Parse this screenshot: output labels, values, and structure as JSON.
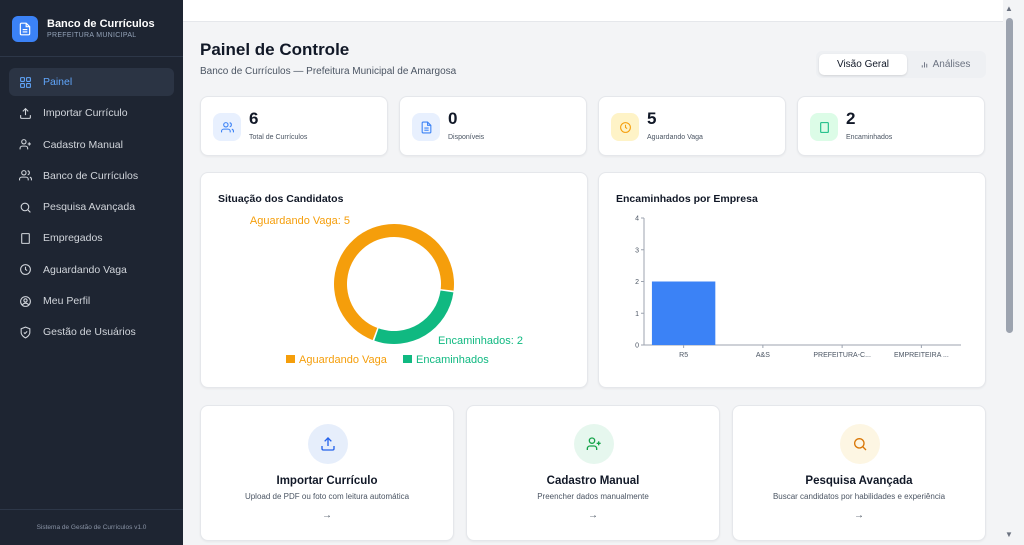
{
  "sidebar": {
    "brand_title": "Banco de Currículos",
    "brand_subtitle": "PREFEITURA MUNICIPAL",
    "items": [
      {
        "label": "Painel",
        "icon": "grid-icon",
        "active": true
      },
      {
        "label": "Importar Currículo",
        "icon": "upload-icon"
      },
      {
        "label": "Cadastro Manual",
        "icon": "user-plus-icon"
      },
      {
        "label": "Banco de Currículos",
        "icon": "users-icon"
      },
      {
        "label": "Pesquisa Avançada",
        "icon": "search-icon"
      },
      {
        "label": "Empregados",
        "icon": "building-icon"
      },
      {
        "label": "Aguardando Vaga",
        "icon": "clock-icon"
      },
      {
        "label": "Meu Perfil",
        "icon": "user-circle-icon"
      },
      {
        "label": "Gestão de Usuários",
        "icon": "shield-icon"
      }
    ],
    "footer": "Sistema de Gestão de Currículos v1.0"
  },
  "header": {
    "title": "Painel de Controle",
    "subtitle": "Banco de Currículos — Prefeitura Municipal de Amargosa",
    "tabs": [
      {
        "label": "Visão Geral",
        "active": true
      },
      {
        "label": "Análises",
        "icon": "bar-chart-icon"
      }
    ]
  },
  "stats": [
    {
      "value": "6",
      "label": "Total de Currículos",
      "icon": "users-icon"
    },
    {
      "value": "0",
      "label": "Disponíveis",
      "icon": "document-icon"
    },
    {
      "value": "5",
      "label": "Aguardando Vaga",
      "icon": "clock-icon"
    },
    {
      "value": "2",
      "label": "Encaminhados",
      "icon": "building-icon"
    }
  ],
  "colors": {
    "accent": "#3b82f6",
    "waiting": "#f59e0b",
    "forwarded": "#10b981",
    "sidebar_bg": "#1e2532"
  },
  "chart_data": [
    {
      "type": "pie",
      "title": "Situação dos Candidatos",
      "slices": [
        {
          "name": "Aguardando Vaga",
          "value": 5,
          "label": "Aguardando Vaga: 5",
          "color": "#f59e0b"
        },
        {
          "name": "Encaminhados",
          "value": 2,
          "label": "Encaminhados: 2",
          "color": "#10b981"
        }
      ],
      "legend": "bottom"
    },
    {
      "type": "bar",
      "title": "Encaminhados por Empresa",
      "categories": [
        "R5",
        "A&S",
        "PREFEITURA-C...",
        "EMPREITEIRA ..."
      ],
      "values": [
        2,
        0,
        0,
        0
      ],
      "ylim": [
        0,
        4
      ],
      "yticks": [
        0,
        1,
        2,
        3,
        4
      ],
      "color": "#3b82f6",
      "xlabel": "",
      "ylabel": ""
    }
  ],
  "actions": [
    {
      "title": "Importar Currículo",
      "description": "Upload de PDF ou foto com leitura automática",
      "arrow": "→",
      "icon": "upload-icon"
    },
    {
      "title": "Cadastro Manual",
      "description": "Preencher dados manualmente",
      "arrow": "→",
      "icon": "user-plus-icon"
    },
    {
      "title": "Pesquisa Avançada",
      "description": "Buscar candidatos por habilidades e experiência",
      "arrow": "→",
      "icon": "search-icon"
    }
  ]
}
